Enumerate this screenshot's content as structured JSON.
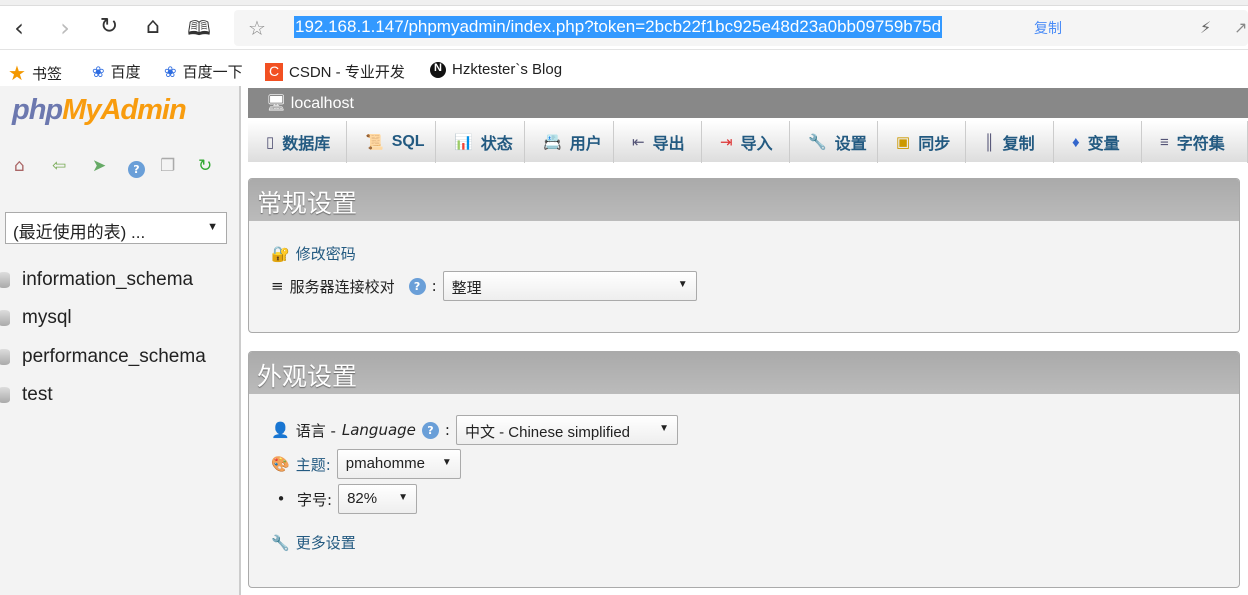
{
  "browser": {
    "url": "192.168.1.147/phpmyadmin/index.php?token=2bcb22f1bc925e48d23a0bb09759b75d",
    "copy_label": "复制",
    "bookmarks": [
      {
        "label": "书签",
        "icon": "star-icon"
      },
      {
        "label": "百度",
        "icon": "baidu-paw-icon"
      },
      {
        "label": "百度一下",
        "icon": "baidu-paw-icon"
      },
      {
        "label": "CSDN - 专业开发",
        "icon": "csdn-icon"
      },
      {
        "label": "Hzktester`s Blog",
        "icon": "n-logo-icon"
      }
    ]
  },
  "sidebar": {
    "logo": "phpMyAdmin",
    "logo_php": "php",
    "logo_myadmin": "MyAdmin",
    "recent_tables": "(最近使用的表) ...",
    "databases": [
      "information_schema",
      "mysql",
      "performance_schema",
      "test"
    ]
  },
  "server": {
    "label": "localhost"
  },
  "tabs": [
    {
      "label": "数据库",
      "icon": "database-icon"
    },
    {
      "label": "SQL",
      "icon": "sql-icon"
    },
    {
      "label": "状态",
      "icon": "status-icon"
    },
    {
      "label": "用户",
      "icon": "users-icon"
    },
    {
      "label": "导出",
      "icon": "export-icon"
    },
    {
      "label": "导入",
      "icon": "import-icon"
    },
    {
      "label": "设置",
      "icon": "wrench-icon"
    },
    {
      "label": "同步",
      "icon": "sync-icon"
    },
    {
      "label": "复制",
      "icon": "replication-icon"
    },
    {
      "label": "变量",
      "icon": "variables-icon"
    },
    {
      "label": "字符集",
      "icon": "charset-icon"
    }
  ],
  "general": {
    "title": "常规设置",
    "change_password": "修改密码",
    "collation_label": "服务器连接校对",
    "collation_value": "整理"
  },
  "appearance": {
    "title": "外观设置",
    "language_label": "语言 - ",
    "language_italic": "Language",
    "language_value": "中文 - Chinese simplified",
    "theme_label": "主题:",
    "theme_value": "pmahomme",
    "fontsize_label": "字号:",
    "fontsize_value": "82%",
    "more_settings": "更多设置"
  }
}
